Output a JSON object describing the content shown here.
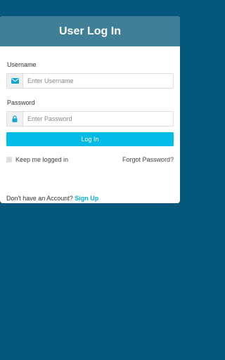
{
  "colors": {
    "background": "#05587b",
    "header": "#407f98",
    "accent": "#02bce7",
    "link": "#05b1d8"
  },
  "header": {
    "title": "User Log In"
  },
  "form": {
    "username": {
      "label": "Username",
      "placeholder": "Enter Username",
      "value": "",
      "icon": "envelope-icon"
    },
    "password": {
      "label": "Password",
      "placeholder": "Enter Password",
      "value": "",
      "icon": "lock-icon"
    },
    "submit_label": "Log In",
    "remember_label": "Keep me logged in",
    "remember_checked": false,
    "forgot_label": "Forgot Password?"
  },
  "signup": {
    "prompt": "Don't have an Account?",
    "link_label": "Sign Up"
  }
}
